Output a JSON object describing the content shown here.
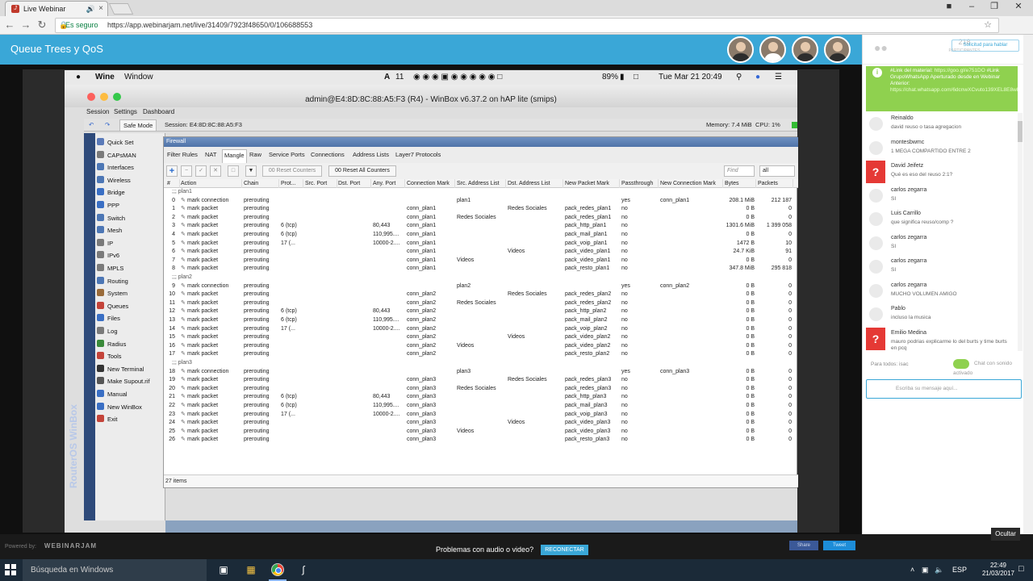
{
  "browser": {
    "tab_title": "Live Webinar",
    "secure_label": "Es seguro",
    "url": "https://app.webinarjam.net/live/31409/7923f48650/0/106688553"
  },
  "webinar": {
    "title": "Queue Trees y QoS"
  },
  "mac": {
    "apple": "",
    "app": "Wine",
    "menu_window": "Window",
    "badge_num": "11",
    "battery": "89%",
    "datetime": "Tue Mar 21  20:49"
  },
  "winbox": {
    "window_title": "admin@E4:8D:8C:88:A5:F3 (R4) - WinBox v6.37.2 on hAP lite (smips)",
    "menu": [
      "Session",
      "Settings",
      "Dashboard"
    ],
    "safe_mode": "Safe Mode",
    "session": "Session:  E4:8D:8C:88:A5:F3",
    "memory": "Memory: 7.4 MiB",
    "cpu": "CPU: 1%",
    "brand": "RouterOS WinBox",
    "sidebar": [
      "Quick Set",
      "CAPsMAN",
      "Interfaces",
      "Wireless",
      "Bridge",
      "PPP",
      "Switch",
      "Mesh",
      "IP",
      "IPv6",
      "MPLS",
      "Routing",
      "System",
      "Queues",
      "Files",
      "Log",
      "Radius",
      "Tools",
      "New Terminal",
      "Make Supout.rif",
      "Manual",
      "New WinBox",
      "Exit"
    ],
    "panel_title": "Firewall",
    "tabs": [
      "Filter Rules",
      "NAT",
      "Mangle",
      "Raw",
      "Service Ports",
      "Connections",
      "Address Lists",
      "Layer7 Protocols"
    ],
    "reset_counters": "00  Reset Counters",
    "reset_all": "00  Reset All Counters",
    "find_placeholder": "Find",
    "filter_value": "all",
    "columns": [
      "#",
      "Action",
      "Chain",
      "Prot...",
      "Src. Port",
      "Dst. Port",
      "Any. Port",
      "Connection Mark",
      "Src. Address List",
      "Dst. Address List",
      "New Packet Mark",
      "Passthrough",
      "New Connection Mark",
      "Bytes",
      "Packets"
    ],
    "rows": [
      {
        "g": ";;; plan1"
      },
      {
        "c": [
          "0",
          "mark connection",
          "prerouting",
          "",
          "",
          "",
          "",
          "",
          "plan1",
          "",
          "",
          "yes",
          "conn_plan1",
          "208.1 MiB",
          "212 187"
        ]
      },
      {
        "c": [
          "1",
          "mark packet",
          "prerouting",
          "",
          "",
          "",
          "",
          "conn_plan1",
          "",
          "Redes Sociales",
          "pack_redes_plan1",
          "no",
          "",
          "0 B",
          "0"
        ]
      },
      {
        "c": [
          "2",
          "mark packet",
          "prerouting",
          "",
          "",
          "",
          "",
          "conn_plan1",
          "Redes Sociales",
          "",
          "pack_redes_plan1",
          "no",
          "",
          "0 B",
          "0"
        ]
      },
      {
        "c": [
          "3",
          "mark packet",
          "prerouting",
          "6 (tcp)",
          "",
          "",
          "80,443",
          "conn_plan1",
          "",
          "",
          "pack_http_plan1",
          "no",
          "",
          "1301.6 MiB",
          "1 399 058"
        ]
      },
      {
        "c": [
          "4",
          "mark packet",
          "prerouting",
          "6 (tcp)",
          "",
          "",
          "110,995....",
          "conn_plan1",
          "",
          "",
          "pack_mail_plan1",
          "no",
          "",
          "0 B",
          "0"
        ]
      },
      {
        "c": [
          "5",
          "mark packet",
          "prerouting",
          "17 (...",
          "",
          "",
          "10000-2....",
          "conn_plan1",
          "",
          "",
          "pack_voip_plan1",
          "no",
          "",
          "1472 B",
          "10"
        ]
      },
      {
        "c": [
          "6",
          "mark packet",
          "prerouting",
          "",
          "",
          "",
          "",
          "conn_plan1",
          "",
          "Videos",
          "pack_video_plan1",
          "no",
          "",
          "24.7 KiB",
          "91"
        ]
      },
      {
        "c": [
          "7",
          "mark packet",
          "prerouting",
          "",
          "",
          "",
          "",
          "conn_plan1",
          "Videos",
          "",
          "pack_video_plan1",
          "no",
          "",
          "0 B",
          "0"
        ]
      },
      {
        "c": [
          "8",
          "mark packet",
          "prerouting",
          "",
          "",
          "",
          "",
          "conn_plan1",
          "",
          "",
          "pack_resto_plan1",
          "no",
          "",
          "347.8 MiB",
          "295 818"
        ]
      },
      {
        "g": ";;; plan2"
      },
      {
        "c": [
          "9",
          "mark connection",
          "prerouting",
          "",
          "",
          "",
          "",
          "",
          "plan2",
          "",
          "",
          "yes",
          "conn_plan2",
          "0 B",
          "0"
        ]
      },
      {
        "c": [
          "10",
          "mark packet",
          "prerouting",
          "",
          "",
          "",
          "",
          "conn_plan2",
          "",
          "Redes Sociales",
          "pack_redes_plan2",
          "no",
          "",
          "0 B",
          "0"
        ]
      },
      {
        "c": [
          "11",
          "mark packet",
          "prerouting",
          "",
          "",
          "",
          "",
          "conn_plan2",
          "Redes Sociales",
          "",
          "pack_redes_plan2",
          "no",
          "",
          "0 B",
          "0"
        ]
      },
      {
        "c": [
          "12",
          "mark packet",
          "prerouting",
          "6 (tcp)",
          "",
          "",
          "80,443",
          "conn_plan2",
          "",
          "",
          "pack_http_plan2",
          "no",
          "",
          "0 B",
          "0"
        ]
      },
      {
        "c": [
          "13",
          "mark packet",
          "prerouting",
          "6 (tcp)",
          "",
          "",
          "110,995....",
          "conn_plan2",
          "",
          "",
          "pack_mail_plan2",
          "no",
          "",
          "0 B",
          "0"
        ]
      },
      {
        "c": [
          "14",
          "mark packet",
          "prerouting",
          "17 (...",
          "",
          "",
          "10000-2....",
          "conn_plan2",
          "",
          "",
          "pack_voip_plan2",
          "no",
          "",
          "0 B",
          "0"
        ]
      },
      {
        "c": [
          "15",
          "mark packet",
          "prerouting",
          "",
          "",
          "",
          "",
          "conn_plan2",
          "",
          "Videos",
          "pack_video_plan2",
          "no",
          "",
          "0 B",
          "0"
        ]
      },
      {
        "c": [
          "16",
          "mark packet",
          "prerouting",
          "",
          "",
          "",
          "",
          "conn_plan2",
          "Videos",
          "",
          "pack_video_plan2",
          "no",
          "",
          "0 B",
          "0"
        ]
      },
      {
        "c": [
          "17",
          "mark packet",
          "prerouting",
          "",
          "",
          "",
          "",
          "conn_plan2",
          "",
          "",
          "pack_resto_plan2",
          "no",
          "",
          "0 B",
          "0"
        ]
      },
      {
        "g": ";;; plan3"
      },
      {
        "c": [
          "18",
          "mark connection",
          "prerouting",
          "",
          "",
          "",
          "",
          "",
          "plan3",
          "",
          "",
          "yes",
          "conn_plan3",
          "0 B",
          "0"
        ]
      },
      {
        "c": [
          "19",
          "mark packet",
          "prerouting",
          "",
          "",
          "",
          "",
          "conn_plan3",
          "",
          "Redes Sociales",
          "pack_redes_plan3",
          "no",
          "",
          "0 B",
          "0"
        ]
      },
      {
        "c": [
          "20",
          "mark packet",
          "prerouting",
          "",
          "",
          "",
          "",
          "conn_plan3",
          "Redes Sociales",
          "",
          "pack_redes_plan3",
          "no",
          "",
          "0 B",
          "0"
        ]
      },
      {
        "c": [
          "21",
          "mark packet",
          "prerouting",
          "6 (tcp)",
          "",
          "",
          "80,443",
          "conn_plan3",
          "",
          "",
          "pack_http_plan3",
          "no",
          "",
          "0 B",
          "0"
        ]
      },
      {
        "c": [
          "22",
          "mark packet",
          "prerouting",
          "6 (tcp)",
          "",
          "",
          "110,995....",
          "conn_plan3",
          "",
          "",
          "pack_mail_plan3",
          "no",
          "",
          "0 B",
          "0"
        ]
      },
      {
        "c": [
          "23",
          "mark packet",
          "prerouting",
          "17 (...",
          "",
          "",
          "10000-2....",
          "conn_plan3",
          "",
          "",
          "pack_voip_plan3",
          "no",
          "",
          "0 B",
          "0"
        ]
      },
      {
        "c": [
          "24",
          "mark packet",
          "prerouting",
          "",
          "",
          "",
          "",
          "conn_plan3",
          "",
          "Videos",
          "pack_video_plan3",
          "no",
          "",
          "0 B",
          "0"
        ]
      },
      {
        "c": [
          "25",
          "mark packet",
          "prerouting",
          "",
          "",
          "",
          "",
          "conn_plan3",
          "Videos",
          "",
          "pack_video_plan3",
          "no",
          "",
          "0 B",
          "0"
        ]
      },
      {
        "c": [
          "26",
          "mark packet",
          "prerouting",
          "",
          "",
          "",
          "",
          "conn_plan3",
          "",
          "",
          "pack_resto_plan3",
          "no",
          "",
          "0 B",
          "0"
        ]
      }
    ],
    "items_count": "27 items"
  },
  "chat": {
    "participants_count": "218",
    "participants_label": "PARTICIPANTES",
    "request_speak": "Solicitud para hablar",
    "pinned_text": "#Link del material: ",
    "pinned_link1": "https://goo.gl/e751DO",
    "pinned_text2": " #Link GrupoWhatsApp Aperturado desde en Webinar Anterior: ",
    "pinned_link2": "https://chat.whatsapp.com/6dcnwXCvuto139XEL8E8wl",
    "messages": [
      {
        "name": "Reinaldo",
        "text": "david reuso o tasa agregacion",
        "q": false
      },
      {
        "name": "montesbwmc",
        "text": "1 MEGA COMPARTIDO ENTRE 2",
        "q": false
      },
      {
        "name": "David Jeifetz",
        "text": "Qué es eso del reuso 2:1?",
        "q": true
      },
      {
        "name": "carlos zegarra",
        "text": "SI",
        "q": false
      },
      {
        "name": "Luis Carrillo",
        "text": "que significa reuso/comp ?",
        "q": false
      },
      {
        "name": "carlos zegarra",
        "text": "SI",
        "q": false
      },
      {
        "name": "carlos zegarra",
        "text": "SI",
        "q": false
      },
      {
        "name": "carlos zegarra",
        "text": "MUCHO VOLUMEN AMIGO",
        "q": false
      },
      {
        "name": "Pablo",
        "text": "incluso la musica",
        "q": false
      },
      {
        "name": "Emilio Medina",
        "text": "mauro podrias explicarme lo del burts y time burts en pcq",
        "q": true
      }
    ],
    "for_all": "Para todos: isac",
    "sound": "Chat con sonido activado",
    "input_placeholder": "Escriba su mensaje aquí..."
  },
  "bottom": {
    "powered_by": "Powered by:",
    "brand": "WEBINARJAM",
    "problem_text": "Problemas con audio o video?",
    "reconnect": "RECONECTAR",
    "share": "Share",
    "tweet": "Tweet",
    "hide": "Ocultar"
  },
  "taskbar": {
    "search": "Búsqueda en Windows",
    "lang": "ESP",
    "time": "22:49",
    "date": "21/03/2017"
  }
}
